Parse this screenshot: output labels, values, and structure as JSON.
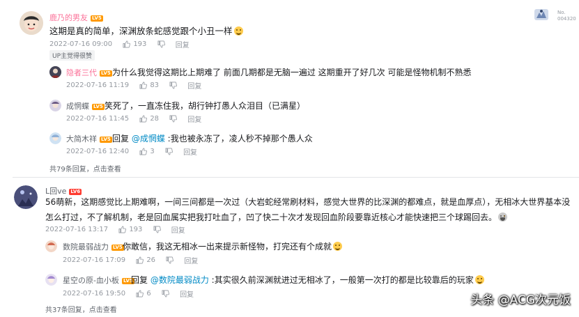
{
  "comments": [
    {
      "user": "鹿乃的男友",
      "level": "LV5",
      "text": "这期是真的简单，深渊放条蛇感觉跟个小丑一样",
      "date": "2022-07-16 09:00",
      "likes": "193",
      "reply_label": "回复",
      "badge": "UP主觉得很赞",
      "medal_no": "No.",
      "medal_num": "004320",
      "replies": [
        {
          "user": "隐者三代",
          "level": "LV5",
          "text": "为什么我觉得这期比上期难了 前面几期都是无脑一遍过 这期重开了好几次 可能是怪物机制不熟悉",
          "date": "2022-07-16 11:19",
          "likes": "83",
          "reply_label": "回复"
        },
        {
          "user": "成惘蝶",
          "level": "LV5",
          "text": "笑死了，一直冻住我，胡行钟打愚人众泪目（已满星）",
          "date": "2022-07-16 11:45",
          "likes": "28",
          "reply_label": "回复"
        },
        {
          "user": "大简木祥",
          "level": "LV5",
          "prefix": "回复 ",
          "mention": "@成惘蝶",
          "text": " :我也被永冻了，凌人秒不掉那个愚人众",
          "date": "2022-07-16 12:40",
          "likes": "3",
          "reply_label": "回复"
        }
      ],
      "summary": "共79条回复，点击查看"
    },
    {
      "user": "L回ve",
      "level": "LV6",
      "text": "56萌新，这期感觉比上期难啊，一间三间都是一次过（大岩蛇经常刷材料，感觉大世界的比深渊的都难点，就是血厚点），无相冰大世界基本没怎么打过，不了解机制，老是回血属实把我打吐血了，凹了快二十次才发现回血阶段要靠近核心才能快速把三个球踢回去。",
      "date": "2022-07-16 13:17",
      "likes": "193",
      "reply_label": "回复",
      "replies": [
        {
          "user": "数院最弱战力",
          "level": "LV5",
          "text": "你敢信，我这无相冰一出来提示新怪物，打完还有个成就",
          "date": "2022-07-16 17:09",
          "likes": "26",
          "reply_label": "回复"
        },
        {
          "user": "星空の原-血小板",
          "level": "LV5",
          "prefix": "回复 ",
          "mention": "@数院最弱战力",
          "text": " :其实很久前深渊就进过无相冰了，一般第一次打的都是比较靠后的玩家",
          "date": "2022-07-16 19:50",
          "likes": "6",
          "reply_label": "回复"
        }
      ],
      "summary": "共37条回复，点击查看"
    }
  ],
  "watermark": "头条 @ACG次元饭"
}
